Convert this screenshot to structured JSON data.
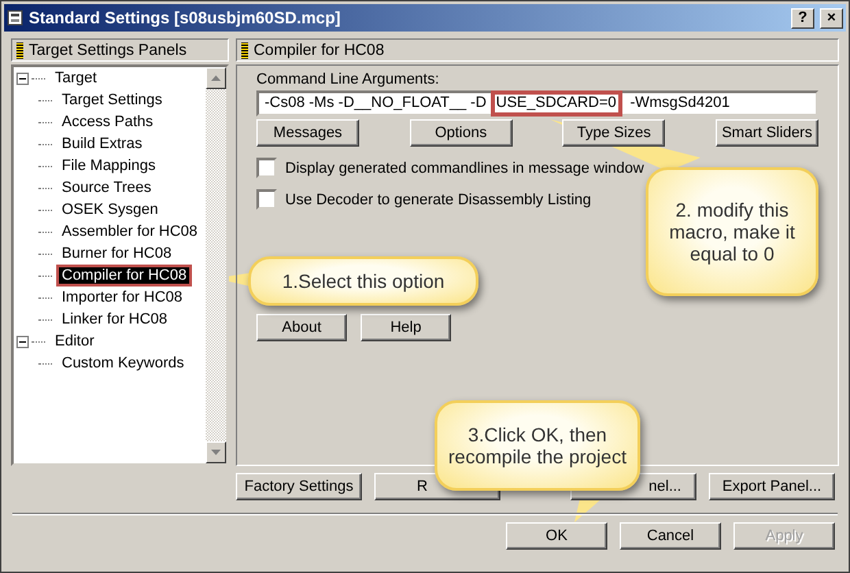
{
  "window": {
    "title": "Standard Settings [s08usbjm60SD.mcp]",
    "help_button": "?",
    "close_button": "×"
  },
  "sidebar": {
    "title": "Target Settings Panels",
    "items": [
      {
        "label": "Target",
        "expanded": true,
        "selected": false,
        "highlighted": false,
        "children": [
          {
            "label": "Target Settings",
            "selected": false,
            "highlighted": false
          },
          {
            "label": "Access Paths",
            "selected": false,
            "highlighted": false
          },
          {
            "label": "Build Extras",
            "selected": false,
            "highlighted": false
          },
          {
            "label": "File Mappings",
            "selected": false,
            "highlighted": false
          },
          {
            "label": "Source Trees",
            "selected": false,
            "highlighted": false
          },
          {
            "label": "OSEK Sysgen",
            "selected": false,
            "highlighted": false
          },
          {
            "label": "Assembler for HC08",
            "selected": false,
            "highlighted": false
          },
          {
            "label": "Burner for HC08",
            "selected": false,
            "highlighted": false
          },
          {
            "label": "Compiler for HC08",
            "selected": true,
            "highlighted": true
          },
          {
            "label": "Importer for HC08",
            "selected": false,
            "highlighted": false
          },
          {
            "label": "Linker for HC08",
            "selected": false,
            "highlighted": false
          }
        ]
      },
      {
        "label": "Editor",
        "expanded": true,
        "selected": false,
        "highlighted": false,
        "children": [
          {
            "label": "Custom Keywords",
            "selected": false,
            "highlighted": false
          }
        ]
      }
    ]
  },
  "panel": {
    "title": "Compiler for HC08",
    "field_label": "Command Line Arguments:",
    "field_parts": [
      {
        "text": "-Cs08 -Ms -D__NO_FLOAT__ -D",
        "highlighted": false
      },
      {
        "text": "USE_SDCARD=0",
        "highlighted": true
      },
      {
        "text": " -WmsgSd4201",
        "highlighted": false
      }
    ],
    "option_buttons": [
      "Messages",
      "Options",
      "Type Sizes",
      "Smart Sliders"
    ],
    "checkboxes": [
      {
        "label": "Display generated commandlines in message window",
        "checked": false
      },
      {
        "label": "Use Decoder to generate Disassembly Listing",
        "checked": false
      }
    ],
    "info_buttons": [
      "About",
      "Help"
    ]
  },
  "panel_buttons": [
    {
      "label": "Factory Settings"
    },
    {
      "label": "R"
    },
    {
      "label": "nel..."
    },
    {
      "label": "Export Panel..."
    }
  ],
  "dialog_buttons": [
    {
      "label": "OK",
      "disabled": false
    },
    {
      "label": "Cancel",
      "disabled": false
    },
    {
      "label": "Apply",
      "disabled": true
    }
  ],
  "callouts": [
    {
      "text": "1.Select this option"
    },
    {
      "text": "2. modify this macro, make it equal to 0"
    },
    {
      "text": "3.Click OK, then recompile the project"
    }
  ]
}
